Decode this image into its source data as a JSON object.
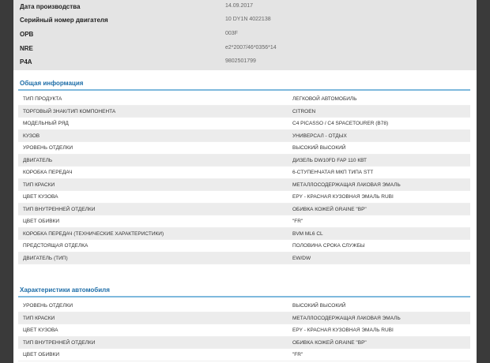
{
  "summary": [
    {
      "label": "Дата производства",
      "value": "14.09.2017"
    },
    {
      "label": "Серийный номер двигателя",
      "value": "10 DY1N 4022138"
    },
    {
      "label": "OPB",
      "value": "003F"
    },
    {
      "label": "NRE",
      "value": "e2*2007/46*0356*14"
    },
    {
      "label": "P4A",
      "value": "9802501799"
    }
  ],
  "general": {
    "title": "Общая информация",
    "rows": [
      {
        "key": "ТИП ПРОДУКТА",
        "value": "ЛЕГКОВОЙ АВТОМОБИЛЬ"
      },
      {
        "key": "ТОРГОВЫЙ ЗНАК/ТИП КОМПОНЕНТА",
        "value": "CITROEN"
      },
      {
        "key": "МОДЕЛЬНЫЙ РЯД",
        "value": "C4 PICASSO / C4 SPACETOURER (B78)"
      },
      {
        "key": "КУЗОВ",
        "value": "УНИВЕРСАЛ - ОТДЫХ"
      },
      {
        "key": "УРОВЕНЬ ОТДЕЛКИ",
        "value": "ВЫСОКИЙ ВЫСОКИЙ"
      },
      {
        "key": "ДВИГАТЕЛЬ",
        "value": "ДИЗЕЛЬ DW10FD FAP 110 КВТ"
      },
      {
        "key": "КОРОБКА ПЕРЕДАЧ",
        "value": "6-СТУПЕНЧАТАЯ МКП ТИПА STT"
      },
      {
        "key": "ТИП КРАСКИ",
        "value": "МЕТАЛЛОСОДЕРЖАЩАЯ ЛАКОВАЯ ЭМАЛЬ"
      },
      {
        "key": "ЦВЕТ КУЗОВА",
        "value": "EPY - КРАСНАЯ КУЗОВНАЯ ЭМАЛЬ RUBI"
      },
      {
        "key": "ТИП ВНУТРЕННЕЙ ОТДЕЛКИ",
        "value": "ОБИВКА КОЖЕЙ GRAINE \"BP\""
      },
      {
        "key": "ЦВЕТ ОБИВКИ",
        "value": "\"FR\""
      },
      {
        "key": "КОРОБКА ПЕРЕДАЧ (ТЕХНИЧЕСКИЕ ХАРАКТЕРИСТИКИ)",
        "value": "BVM ML6 CL"
      },
      {
        "key": "ПРЕДСТОЯЩАЯ ОТДЕЛКА",
        "value": "ПОЛОВИНА СРОКА СЛУЖБЫ"
      },
      {
        "key": "ДВИГАТЕЛЬ (ТИП)",
        "value": "EW/DW"
      }
    ]
  },
  "characteristics": {
    "title": "Характеристики автомобиля",
    "rows": [
      {
        "key": "УРОВЕНЬ ОТДЕЛКИ",
        "value": "ВЫСОКИЙ ВЫСОКИЙ"
      },
      {
        "key": "ТИП КРАСКИ",
        "value": "МЕТАЛЛОСОДЕРЖАЩАЯ ЛАКОВАЯ ЭМАЛЬ"
      },
      {
        "key": "ЦВЕТ КУЗОВА",
        "value": "EPY - КРАСНАЯ КУЗОВНАЯ ЭМАЛЬ RUBI"
      },
      {
        "key": "ТИП ВНУТРЕННЕЙ ОТДЕЛКИ",
        "value": "ОБИВКА КОЖЕЙ GRAINE \"BP\""
      },
      {
        "key": "ЦВЕТ ОБИВКИ",
        "value": "\"FR\""
      }
    ]
  },
  "colors": {
    "accent": "#1f6ea8",
    "divider": "#7fb9dd",
    "summary_bg": "#e4e4e4",
    "alt_row": "#ececec"
  }
}
